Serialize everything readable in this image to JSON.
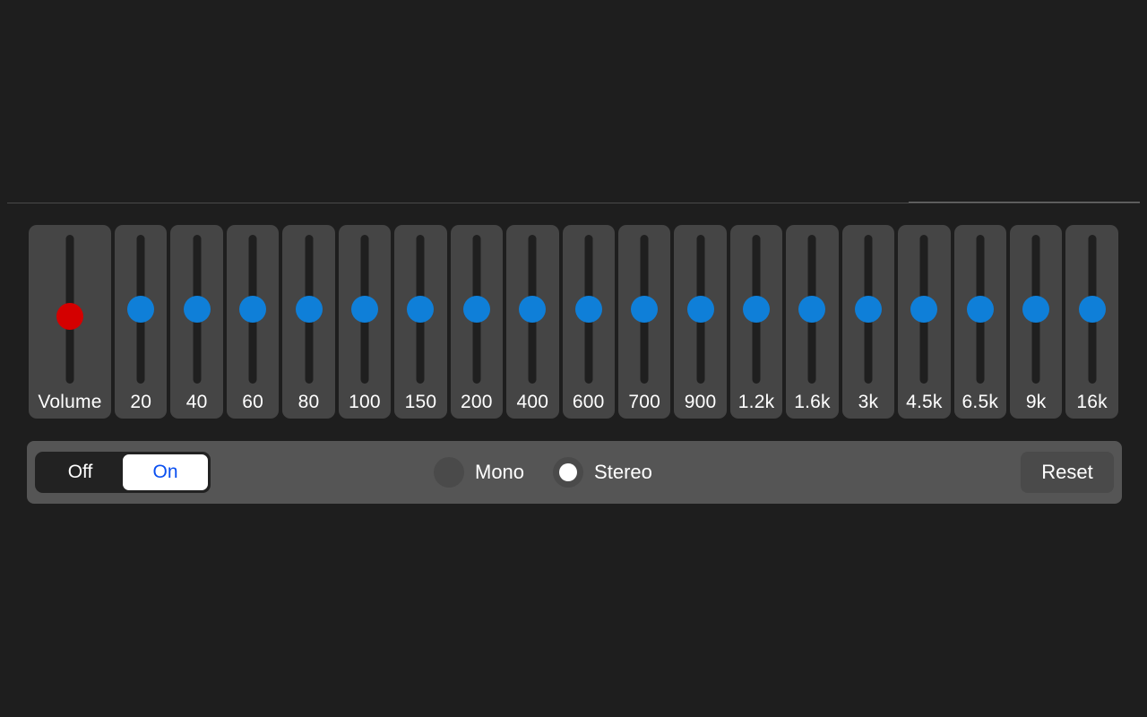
{
  "window": {
    "background": "#1e1e1e",
    "panel_background": "#454545",
    "bar_background": "#555555"
  },
  "colors": {
    "thumb_blue": "#0f7fd8",
    "thumb_red": "#d40000",
    "accent_blue_text": "#0a4ff0",
    "track": "#1f1f1f"
  },
  "equalizer": {
    "volume": {
      "label": "Volume",
      "thumb_color": "#d40000",
      "value_pct": 45
    },
    "bands": [
      {
        "label": "20",
        "value_pct": 50
      },
      {
        "label": "40",
        "value_pct": 50
      },
      {
        "label": "60",
        "value_pct": 50
      },
      {
        "label": "80",
        "value_pct": 50
      },
      {
        "label": "100",
        "value_pct": 50
      },
      {
        "label": "150",
        "value_pct": 50
      },
      {
        "label": "200",
        "value_pct": 50
      },
      {
        "label": "400",
        "value_pct": 50
      },
      {
        "label": "600",
        "value_pct": 50
      },
      {
        "label": "700",
        "value_pct": 50
      },
      {
        "label": "900",
        "value_pct": 50
      },
      {
        "label": "1.2k",
        "value_pct": 50
      },
      {
        "label": "1.6k",
        "value_pct": 50
      },
      {
        "label": "3k",
        "value_pct": 50
      },
      {
        "label": "4.5k",
        "value_pct": 50
      },
      {
        "label": "6.5k",
        "value_pct": 50
      },
      {
        "label": "9k",
        "value_pct": 50
      },
      {
        "label": "16k",
        "value_pct": 50
      }
    ]
  },
  "controls": {
    "power": {
      "options": [
        "Off",
        "On"
      ],
      "selected": "On"
    },
    "channel": {
      "options": [
        "Mono",
        "Stereo"
      ],
      "selected": "Stereo"
    },
    "reset_label": "Reset"
  }
}
